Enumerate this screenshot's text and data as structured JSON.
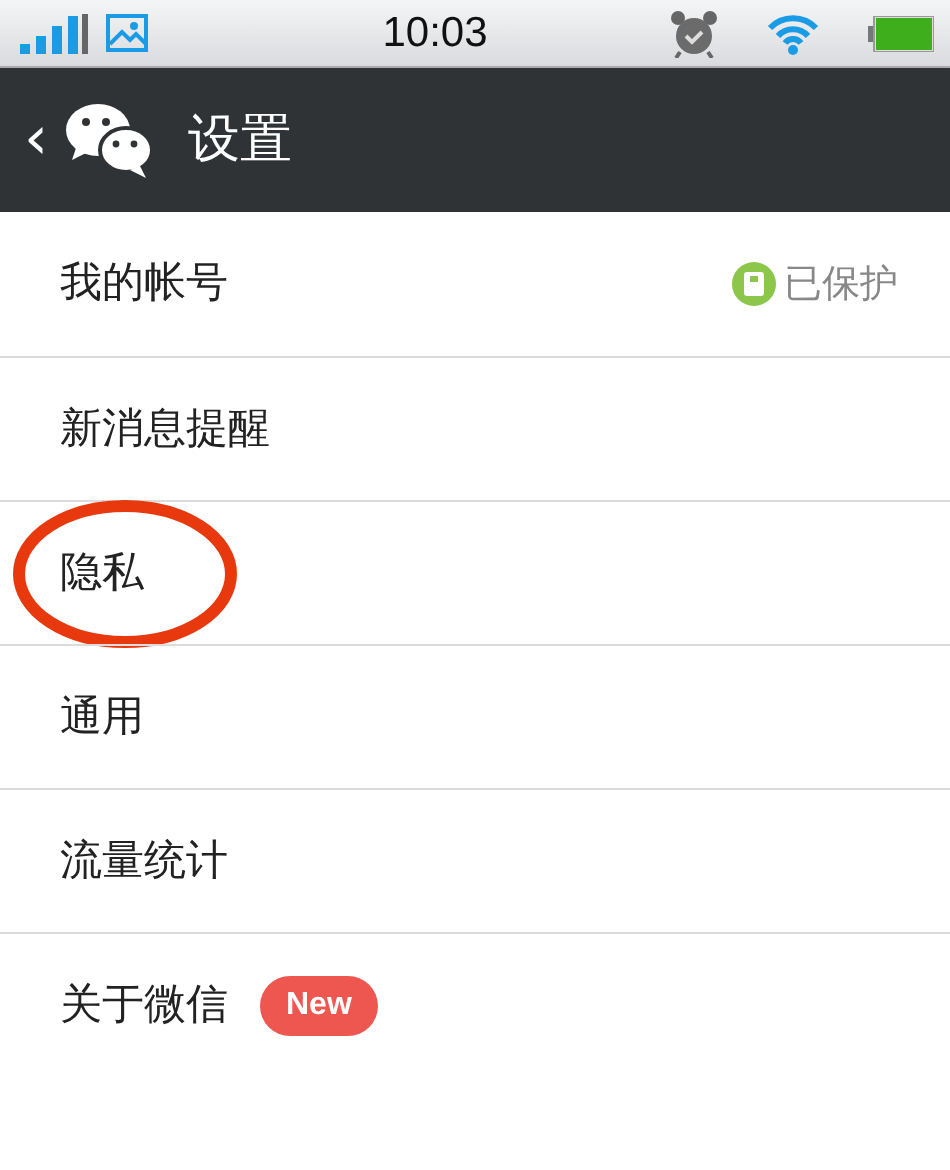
{
  "status_bar": {
    "time": "10:03"
  },
  "header": {
    "title": "设置",
    "back": "‹"
  },
  "items": [
    {
      "label": "我的帐号",
      "status": "已保护",
      "circled": false
    },
    {
      "label": "新消息提醒",
      "circled": false
    },
    {
      "label": "隐私",
      "circled": true
    },
    {
      "label": "通用",
      "circled": false
    },
    {
      "label": "流量统计",
      "circled": false
    },
    {
      "label": "关于微信",
      "badge": "New",
      "circled": false
    }
  ]
}
